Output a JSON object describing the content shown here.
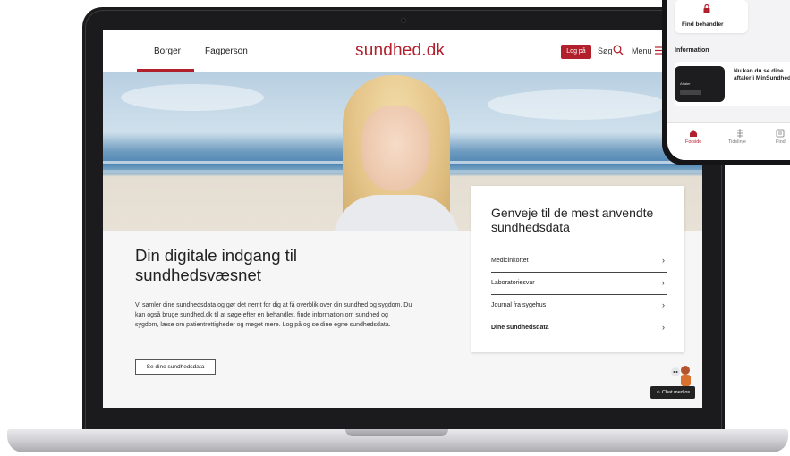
{
  "site": {
    "logo": "sundhed.dk",
    "nav": {
      "tabs": [
        {
          "label": "Borger",
          "active": true
        },
        {
          "label": "Fagperson",
          "active": false
        }
      ],
      "login_label": "Log på",
      "search_label": "Søg",
      "menu_label": "Menu"
    },
    "hero": {
      "headline": "Din digitale indgang til sundhedsvæsnet",
      "body": "Vi samler dine sundhedsdata og gør det nemt for dig at få overblik over din sundhed og sygdom. Du kan også bruge sundhed.dk til at søge efter en behandler, finde information om sundhed og sygdom, læse om patientrettigheder og meget mere. Log på og se dine egne sundhedsdata.",
      "cta_label": "Se dine sundhedsdata"
    },
    "shortcuts": {
      "title": "Genveje til de mest anvendte sundhedsdata",
      "items": [
        {
          "label": "Medicinkortet",
          "bold": false
        },
        {
          "label": "Laboratoriesvar",
          "bold": false
        },
        {
          "label": "Journal fra sygehus",
          "bold": false
        },
        {
          "label": "Dine sundhedsdata",
          "bold": true
        }
      ]
    },
    "chat_label": "Chat med os"
  },
  "phone_app": {
    "find_card_label": "Find behandler",
    "info_heading": "Information",
    "info_card": {
      "mini_label": "Aftaler",
      "text": "Nu kan du se dine aftaler i MinSundhed"
    },
    "tabbar": [
      {
        "label": "Forside",
        "active": true
      },
      {
        "label": "Tidslinje",
        "active": false
      },
      {
        "label": "Find",
        "active": false
      }
    ]
  },
  "colors": {
    "brand_red": "#b3202d",
    "text_dark": "#222222",
    "content_bg": "#f6f6f6"
  }
}
